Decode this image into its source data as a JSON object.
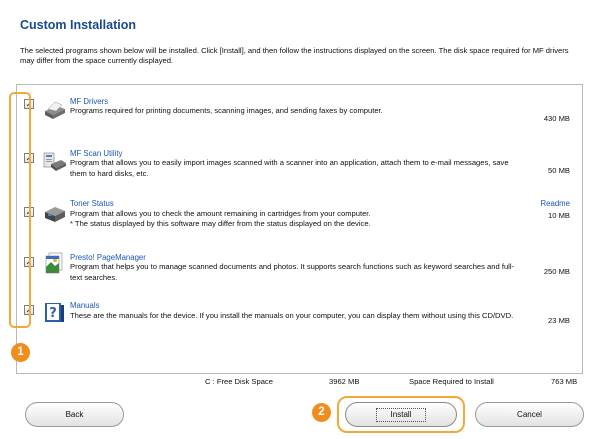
{
  "window": {
    "title": "Custom Installation",
    "description": "The selected programs shown below will be installed. Click [Install], and then follow the instructions displayed on the screen. The disk space required for MF drivers may differ from the space currently displayed."
  },
  "programs": [
    {
      "name": "MF Drivers",
      "desc": "Programs required for printing documents, scanning images, and sending faxes by computer.",
      "size": "430 MB",
      "checked": true,
      "icon": "printer-icon"
    },
    {
      "name": "MF Scan Utility",
      "desc": "Program that allows you to easily import images scanned with a scanner into an application, attach them to e-mail messages, save them to hard disks, etc.",
      "size": "50 MB",
      "checked": true,
      "icon": "scanner-icon"
    },
    {
      "name": "Toner Status",
      "desc": "Program that allows you to check the amount remaining in cartridges from your computer.",
      "note": "* The status displayed by this software may differ from the status displayed on the device.",
      "size": "10 MB",
      "readme": "Readme",
      "checked": true,
      "icon": "toner-icon"
    },
    {
      "name": "Presto! PageManager",
      "desc": "Program that helps you to manage scanned documents and photos. It supports search functions such as keyword searches and full-text searches.",
      "size": "250 MB",
      "checked": true,
      "icon": "page-manager-icon"
    },
    {
      "name": "Manuals",
      "desc": "These are the manuals for the device. If you install the manuals on your computer, you can display them without using this CD/DVD.",
      "size": "23 MB",
      "checked": true,
      "icon": "manual-help-icon"
    }
  ],
  "disk": {
    "free_label": "C : Free Disk Space",
    "free_value": "3962 MB",
    "required_label": "Space Required to Install",
    "required_value": "763 MB"
  },
  "buttons": {
    "back": "Back",
    "install": "Install",
    "cancel": "Cancel"
  },
  "callouts": {
    "first": "1",
    "second": "2"
  },
  "colors": {
    "title": "#1a4a8a",
    "link": "#1d56b5",
    "callout": "#f08d1c",
    "highlight": "#f3a93a"
  }
}
